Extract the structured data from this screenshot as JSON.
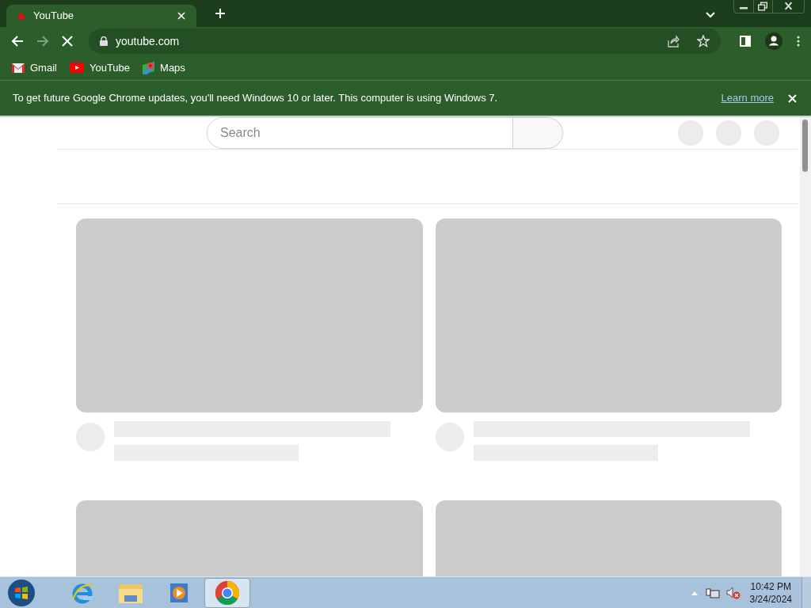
{
  "tab": {
    "title": "YouTube",
    "selected": true
  },
  "address": {
    "url": "youtube.com"
  },
  "bookmarks": [
    {
      "label": "Gmail",
      "kind": "mail"
    },
    {
      "label": "YouTube",
      "kind": "video"
    },
    {
      "label": "Maps",
      "kind": "map"
    }
  ],
  "infobar": {
    "message": "To get future Google Chrome updates, you'll need Windows 10 or later. This computer is using Windows 7.",
    "link": "Learn more"
  },
  "page": {
    "search": {
      "placeholder": "Search"
    }
  },
  "taskbar": {
    "apps": [
      {
        "kind": "browser-e",
        "selected": false
      },
      {
        "kind": "folder",
        "selected": false
      },
      {
        "kind": "media",
        "selected": false
      },
      {
        "kind": "chrome",
        "selected": true
      }
    ],
    "time": "10:42 PM",
    "date": "3/24/2024"
  }
}
